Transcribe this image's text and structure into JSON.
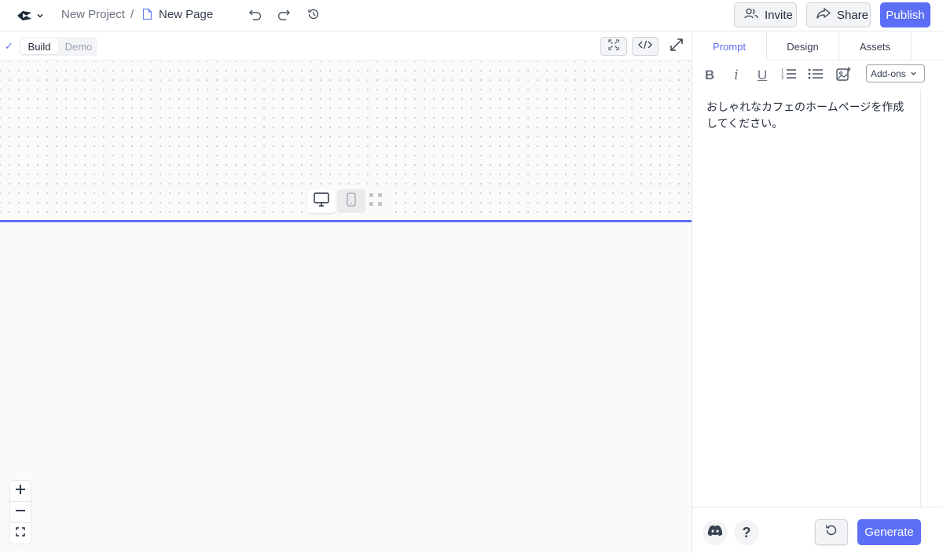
{
  "header": {
    "logo_icon": "app-logo-icon",
    "project_name": "New Project",
    "separator": "/",
    "page_name": "New Page",
    "invite_label": "Invite",
    "share_label": "Share",
    "publish_label": "Publish"
  },
  "canvas": {
    "mode_build": "Build",
    "mode_demo": "Demo",
    "active_mode": "Build",
    "active_device": "desktop"
  },
  "panel": {
    "tabs": [
      {
        "label": "Prompt",
        "active": true
      },
      {
        "label": "Design",
        "active": false
      },
      {
        "label": "Assets",
        "active": false
      }
    ],
    "format": {
      "bold": "B",
      "italic": "i",
      "underline": "U",
      "addons_label": "Add-ons"
    },
    "prompt_text": "おしゃれなカフェのホームページを作成してください。",
    "help_label": "?",
    "generate_label": "Generate"
  },
  "colors": {
    "accent": "#5b6ef5",
    "border": "#e5e7eb",
    "canvas_bg": "#fafafa"
  }
}
